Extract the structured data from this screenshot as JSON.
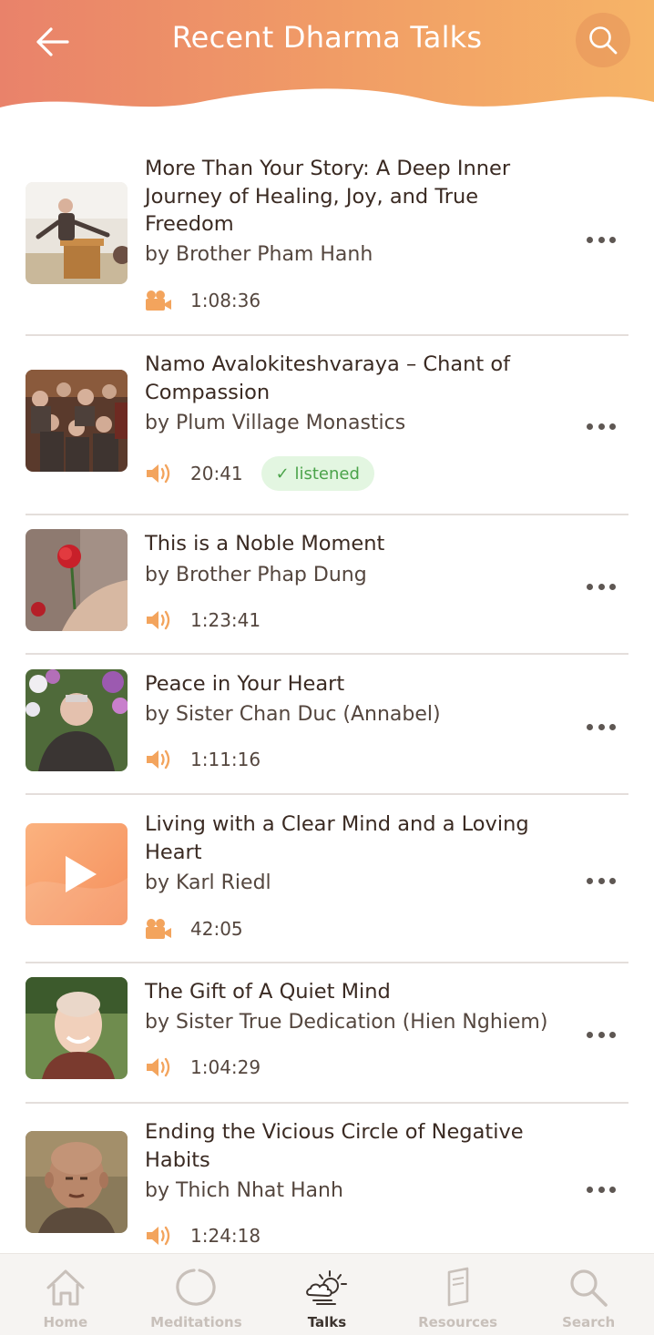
{
  "header": {
    "title": "Recent Dharma Talks",
    "back_icon": "arrow-left-icon",
    "search_icon": "search-icon",
    "gradient": [
      "#ea8468",
      "#f5b066"
    ]
  },
  "talks": [
    {
      "title": "More Than Your Story: A Deep Inner Journey of Healing, Joy, and True Freedom",
      "author": "by Brother Pham Hanh",
      "media": "video-camera-icon",
      "duration": "1:08:36",
      "badge": ""
    },
    {
      "title": "Namo Avalokiteshvaraya – Chant of Compassion",
      "author": "by Plum Village Monastics",
      "media": "speaker-icon",
      "duration": "20:41",
      "badge": "✓ listened"
    },
    {
      "title": "This is a Noble Moment",
      "author": "by Brother Phap Dung",
      "media": "speaker-icon",
      "duration": "1:23:41",
      "badge": ""
    },
    {
      "title": "Peace in Your Heart",
      "author": "by Sister Chan Duc (Annabel)",
      "media": "speaker-icon",
      "duration": "1:11:16",
      "badge": ""
    },
    {
      "title": "Living with a Clear Mind and a Loving Heart",
      "author": "by Karl Riedl",
      "media": "video-camera-icon",
      "duration": "42:05",
      "badge": ""
    },
    {
      "title": "The Gift of A Quiet Mind",
      "author": "by Sister True Dedication (Hien Nghiem)",
      "media": "speaker-icon",
      "duration": "1:04:29",
      "badge": ""
    },
    {
      "title": "Ending the Vicious Circle of Negative Habits",
      "author": "by Thich Nhat Hanh",
      "media": "speaker-icon",
      "duration": "1:24:18",
      "badge": ""
    }
  ],
  "nav": {
    "items": [
      {
        "label": "Home",
        "icon": "home-icon",
        "active": false
      },
      {
        "label": "Meditations",
        "icon": "circle-icon",
        "active": false
      },
      {
        "label": "Talks",
        "icon": "sun-cloud-icon",
        "active": true
      },
      {
        "label": "Resources",
        "icon": "book-icon",
        "active": false
      },
      {
        "label": "Search",
        "icon": "search-icon",
        "active": false
      }
    ]
  },
  "colors": {
    "accent": "#f0a15e",
    "listened_bg": "#e3f6e1",
    "listened_text": "#4ba34a",
    "nav_inactive": "#c8c0ba"
  }
}
